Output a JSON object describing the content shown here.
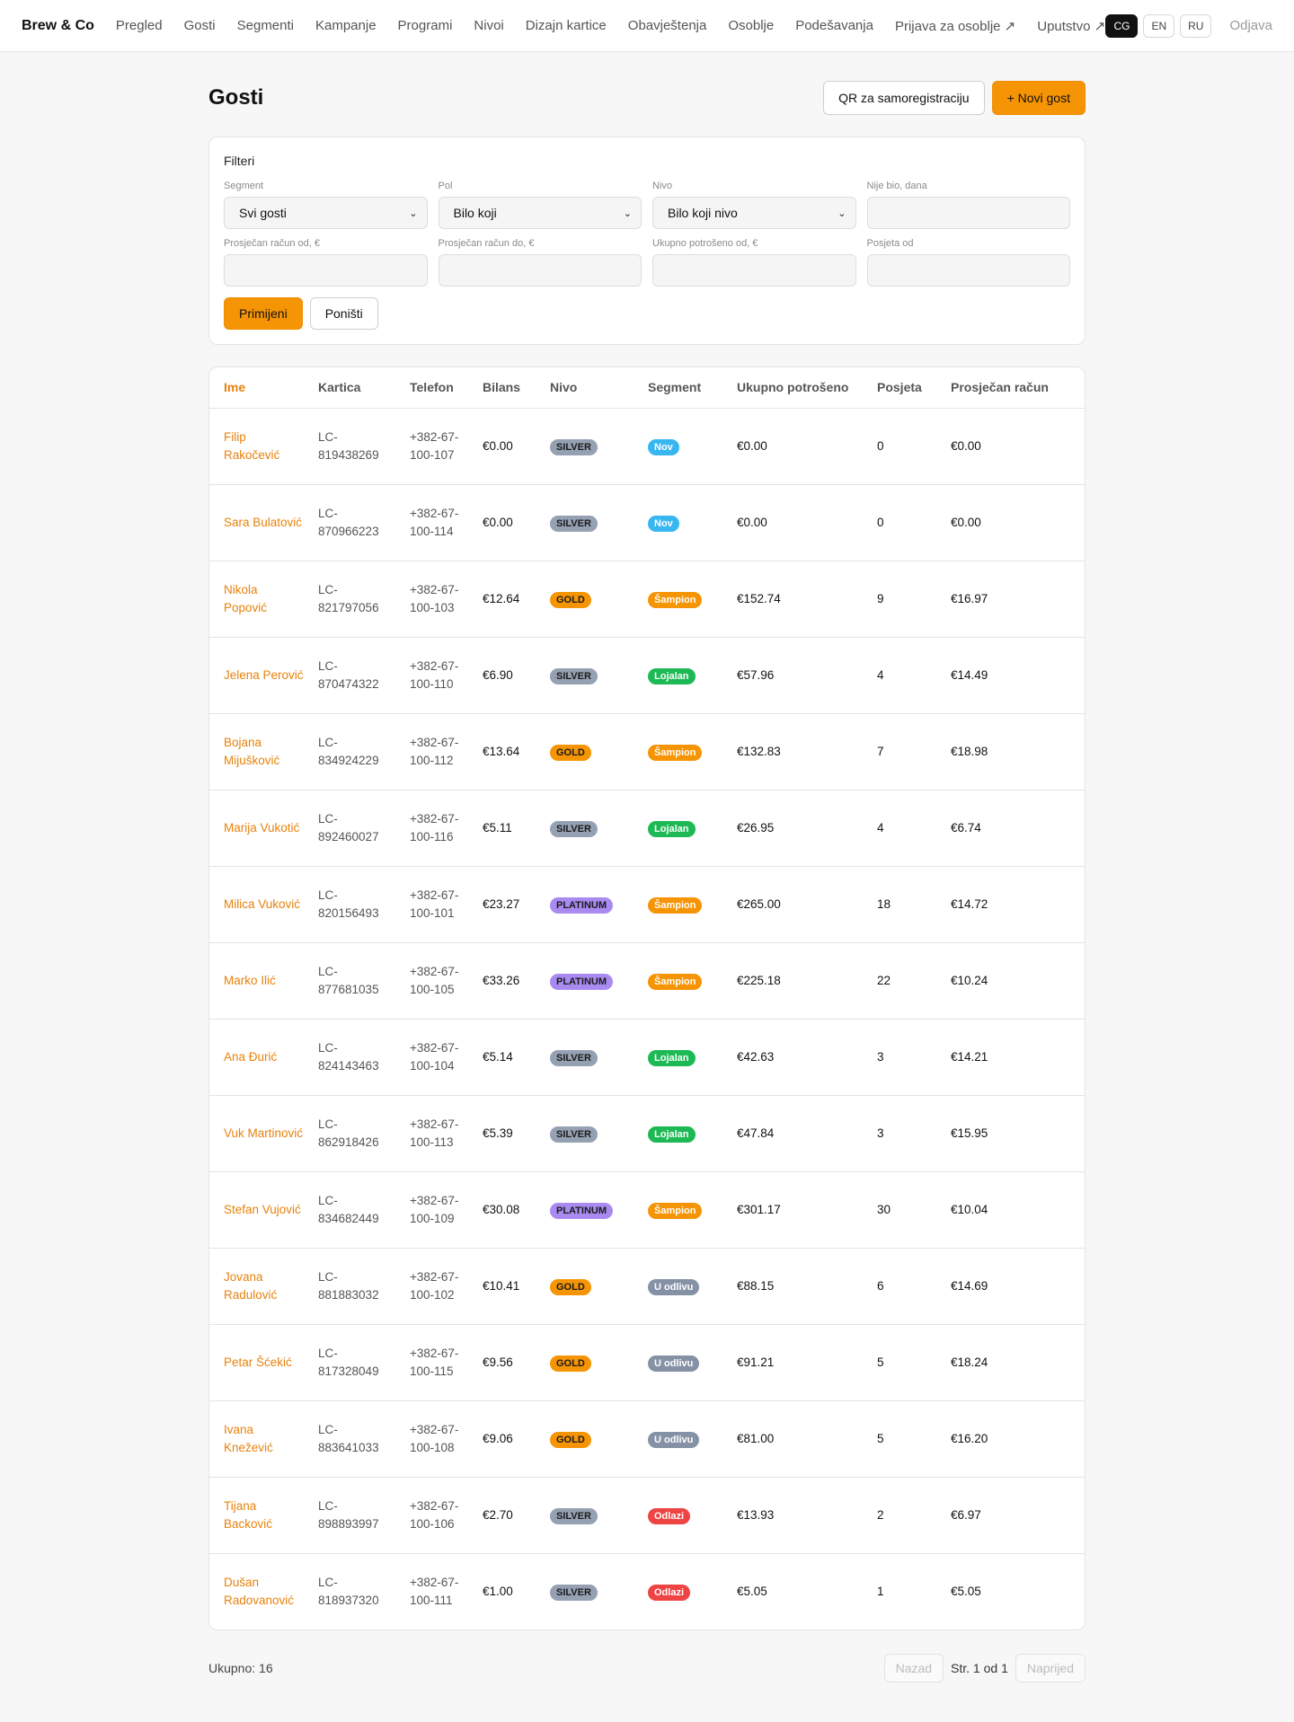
{
  "nav": {
    "brand": "Brew & Co",
    "links": [
      "Pregled",
      "Gosti",
      "Segmenti",
      "Kampanje",
      "Programi",
      "Nivoi",
      "Dizajn kartice",
      "Obavještenja",
      "Osoblje",
      "Podešavanja",
      "Prijava za osoblje ↗",
      "Uputstvo ↗"
    ],
    "langs": [
      "CG",
      "EN",
      "RU"
    ],
    "active_lang": "CG",
    "logout": "Odjava"
  },
  "page": {
    "title": "Gosti",
    "qr_button": "QR za samoregistraciju",
    "new_guest_button": "+ Novi gost"
  },
  "filters": {
    "title": "Filteri",
    "segment": {
      "label": "Segment",
      "value": "Svi gosti"
    },
    "gender": {
      "label": "Pol",
      "value": "Bilo koji"
    },
    "level": {
      "label": "Nivo",
      "value": "Bilo koji nivo"
    },
    "not_visited": {
      "label": "Nije bio, dana",
      "value": ""
    },
    "avg_from": {
      "label": "Prosječan račun od, €",
      "value": ""
    },
    "avg_to": {
      "label": "Prosječan račun do, €",
      "value": ""
    },
    "total_from": {
      "label": "Ukupno potrošeno od, €",
      "value": ""
    },
    "visits_from": {
      "label": "Posjeta od",
      "value": ""
    },
    "apply": "Primijeni",
    "reset": "Poništi"
  },
  "table": {
    "headers": [
      "Ime",
      "Kartica",
      "Telefon",
      "Bilans",
      "Nivo",
      "Segment",
      "Ukupno potrošeno",
      "Posjeta",
      "Prosječan račun"
    ],
    "rows": [
      {
        "name": "Filip Rakočević",
        "card": "LC-819438269",
        "phone": "+382-67-100-107",
        "balance": "€0.00",
        "level": "SILVER",
        "segment": "Nov",
        "total": "€0.00",
        "visits": "0",
        "avg": "€0.00"
      },
      {
        "name": "Sara Bulatović",
        "card": "LC-870966223",
        "phone": "+382-67-100-114",
        "balance": "€0.00",
        "level": "SILVER",
        "segment": "Nov",
        "total": "€0.00",
        "visits": "0",
        "avg": "€0.00"
      },
      {
        "name": "Nikola Popović",
        "card": "LC-821797056",
        "phone": "+382-67-100-103",
        "balance": "€12.64",
        "level": "GOLD",
        "segment": "Šampion",
        "total": "€152.74",
        "visits": "9",
        "avg": "€16.97"
      },
      {
        "name": "Jelena Perović",
        "card": "LC-870474322",
        "phone": "+382-67-100-110",
        "balance": "€6.90",
        "level": "SILVER",
        "segment": "Lojalan",
        "total": "€57.96",
        "visits": "4",
        "avg": "€14.49"
      },
      {
        "name": "Bojana Mijušković",
        "card": "LC-834924229",
        "phone": "+382-67-100-112",
        "balance": "€13.64",
        "level": "GOLD",
        "segment": "Šampion",
        "total": "€132.83",
        "visits": "7",
        "avg": "€18.98"
      },
      {
        "name": "Marija Vukotić",
        "card": "LC-892460027",
        "phone": "+382-67-100-116",
        "balance": "€5.11",
        "level": "SILVER",
        "segment": "Lojalan",
        "total": "€26.95",
        "visits": "4",
        "avg": "€6.74"
      },
      {
        "name": "Milica Vuković",
        "card": "LC-820156493",
        "phone": "+382-67-100-101",
        "balance": "€23.27",
        "level": "PLATINUM",
        "segment": "Šampion",
        "total": "€265.00",
        "visits": "18",
        "avg": "€14.72"
      },
      {
        "name": "Marko Ilić",
        "card": "LC-877681035",
        "phone": "+382-67-100-105",
        "balance": "€33.26",
        "level": "PLATINUM",
        "segment": "Šampion",
        "total": "€225.18",
        "visits": "22",
        "avg": "€10.24"
      },
      {
        "name": "Ana Đurić",
        "card": "LC-824143463",
        "phone": "+382-67-100-104",
        "balance": "€5.14",
        "level": "SILVER",
        "segment": "Lojalan",
        "total": "€42.63",
        "visits": "3",
        "avg": "€14.21"
      },
      {
        "name": "Vuk Martinović",
        "card": "LC-862918426",
        "phone": "+382-67-100-113",
        "balance": "€5.39",
        "level": "SILVER",
        "segment": "Lojalan",
        "total": "€47.84",
        "visits": "3",
        "avg": "€15.95"
      },
      {
        "name": "Stefan Vujović",
        "card": "LC-834682449",
        "phone": "+382-67-100-109",
        "balance": "€30.08",
        "level": "PLATINUM",
        "segment": "Šampion",
        "total": "€301.17",
        "visits": "30",
        "avg": "€10.04"
      },
      {
        "name": "Jovana Radulović",
        "card": "LC-881883032",
        "phone": "+382-67-100-102",
        "balance": "€10.41",
        "level": "GOLD",
        "segment": "U odlivu",
        "total": "€88.15",
        "visits": "6",
        "avg": "€14.69"
      },
      {
        "name": "Petar Šćekić",
        "card": "LC-817328049",
        "phone": "+382-67-100-115",
        "balance": "€9.56",
        "level": "GOLD",
        "segment": "U odlivu",
        "total": "€91.21",
        "visits": "5",
        "avg": "€18.24"
      },
      {
        "name": "Ivana Knežević",
        "card": "LC-883641033",
        "phone": "+382-67-100-108",
        "balance": "€9.06",
        "level": "GOLD",
        "segment": "U odlivu",
        "total": "€81.00",
        "visits": "5",
        "avg": "€16.20"
      },
      {
        "name": "Tijana Backović",
        "card": "LC-898893997",
        "phone": "+382-67-100-106",
        "balance": "€2.70",
        "level": "SILVER",
        "segment": "Odlazi",
        "total": "€13.93",
        "visits": "2",
        "avg": "€6.97"
      },
      {
        "name": "Dušan Radovanović",
        "card": "LC-818937320",
        "phone": "+382-67-100-111",
        "balance": "€1.00",
        "level": "SILVER",
        "segment": "Odlazi",
        "total": "€5.05",
        "visits": "1",
        "avg": "€5.05"
      }
    ]
  },
  "footer": {
    "total": "Ukupno: 16",
    "prev": "Nazad",
    "page_info": "Str. 1 od 1",
    "next": "Naprijed"
  },
  "colors": {
    "accent": "#f59405",
    "link": "#e8820c",
    "silver": "#95a1b2",
    "gold": "#f59405",
    "platinum": "#a98af0",
    "seg_nov": "#38b6f0",
    "seg_lojalan": "#1db954",
    "seg_odlivu": "#8591a4",
    "seg_odlazi": "#ef4444"
  }
}
